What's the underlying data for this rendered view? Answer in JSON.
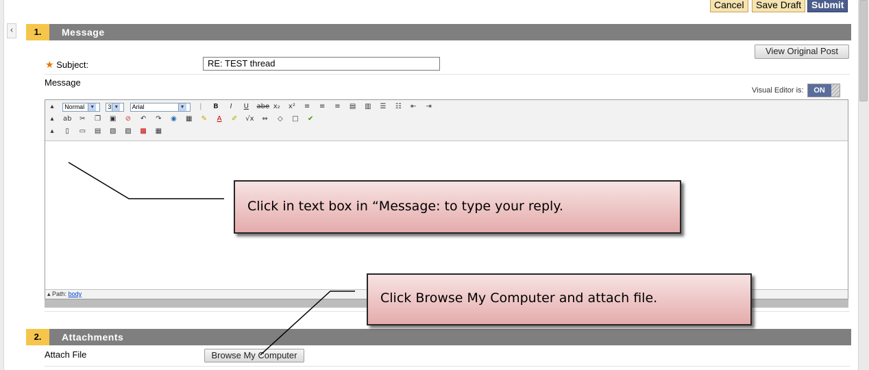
{
  "header_buttons": {
    "cancel": "Cancel",
    "save_draft": "Save Draft",
    "submit": "Submit"
  },
  "section1": {
    "number": "1.",
    "title": "Message"
  },
  "view_original_post": "View Original Post",
  "subject": {
    "label": "Subject:",
    "value": "RE: TEST thread"
  },
  "message_label": "Message",
  "visual_editor": {
    "label": "Visual Editor is:",
    "state": "ON"
  },
  "toolbar": {
    "style_select": "Normal",
    "size_select": "3",
    "font_select": "Arial",
    "row1_icons": [
      "bold-icon",
      "italic-icon",
      "underline-icon",
      "strikethrough-icon",
      "subscript-icon",
      "superscript-icon",
      "align-left-icon",
      "align-center-icon",
      "align-right-icon",
      "paste-text-icon",
      "paste-word-icon",
      "numbered-list-icon",
      "bulleted-list-icon",
      "outdent-icon",
      "indent-icon"
    ],
    "row2_icons": [
      "spellcheck-icon",
      "cut-icon",
      "copy-icon",
      "paste-icon",
      "unlink-icon",
      "undo-icon",
      "redo-icon",
      "link-icon",
      "table-icon",
      "draw-icon",
      "text-color-icon",
      "highlight-icon",
      "math-icon",
      "mashup-icon",
      "code-icon",
      "insert-box-icon",
      "check-icon"
    ],
    "row3_icons": [
      "insert-file-icon",
      "insert-image-icon",
      "insert-media-icon",
      "preview-icon",
      "template-icon",
      "pdf-icon",
      "html-icon"
    ]
  },
  "path": {
    "label": "Path:",
    "value": "body"
  },
  "section2": {
    "number": "2.",
    "title": "Attachments"
  },
  "attach": {
    "label": "Attach File",
    "button": "Browse My Computer"
  },
  "callouts": {
    "message": "Click in text box in “Message: to type your reply.",
    "browse": "Click Browse My Computer and attach file."
  },
  "colors": {
    "section_header": "#7f7f7f",
    "section_number": "#f5c64b",
    "callout_fill": "#e5abab",
    "toggle_on": "#5a6e9b"
  }
}
